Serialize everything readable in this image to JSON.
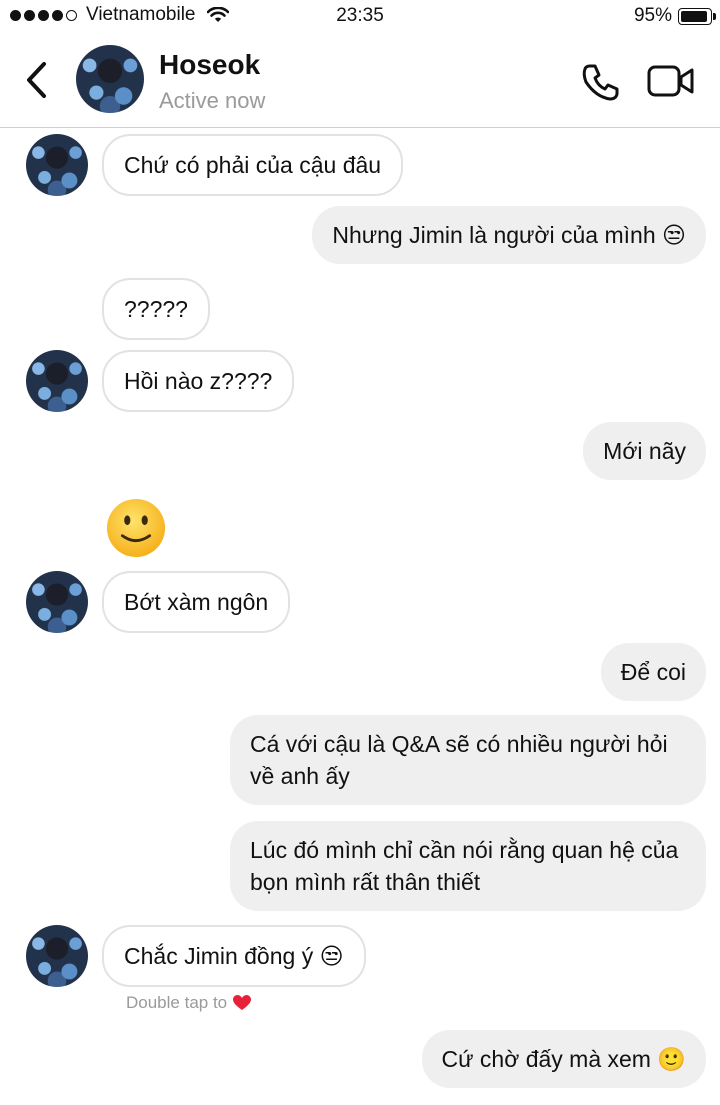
{
  "status_bar": {
    "carrier": "Vietnamobile",
    "time": "23:35",
    "battery": "95%"
  },
  "header": {
    "contact_name": "Hoseok",
    "status": "Active now"
  },
  "messages": [
    {
      "side": "in",
      "text": "Chứ có phải của cậu đâu"
    },
    {
      "side": "out",
      "text": "Nhưng Jimin là người của mình 😒"
    },
    {
      "side": "in",
      "text": "?????"
    },
    {
      "side": "in",
      "text": "Hồi nào z????"
    },
    {
      "side": "out",
      "text": "Mới nãy"
    },
    {
      "side": "in",
      "text": "🙂",
      "type": "emoji"
    },
    {
      "side": "in",
      "text": "Bớt xàm ngôn"
    },
    {
      "side": "out",
      "text": "Để coi"
    },
    {
      "side": "out",
      "text": "Cá với cậu là Q&A sẽ có nhiều người hỏi về anh ấy"
    },
    {
      "side": "out",
      "text": "Lúc đó mình chỉ cần nói rằng quan hệ của bọn mình rất thân thiết"
    },
    {
      "side": "in",
      "text": "Chắc Jimin đồng ý 😒"
    },
    {
      "side": "out",
      "text": "Cứ chờ đấy mà xem 🙂"
    }
  ],
  "double_tap_hint": "Double tap to",
  "colors": {
    "outgoing_bubble": "#efefef",
    "incoming_border": "#e2e2e2",
    "muted_text": "#9a9a9a",
    "heart": "#e8213b"
  },
  "icons": [
    "back-chevron-icon",
    "phone-icon",
    "video-camera-icon",
    "wifi-icon",
    "battery-icon",
    "heart-icon"
  ]
}
